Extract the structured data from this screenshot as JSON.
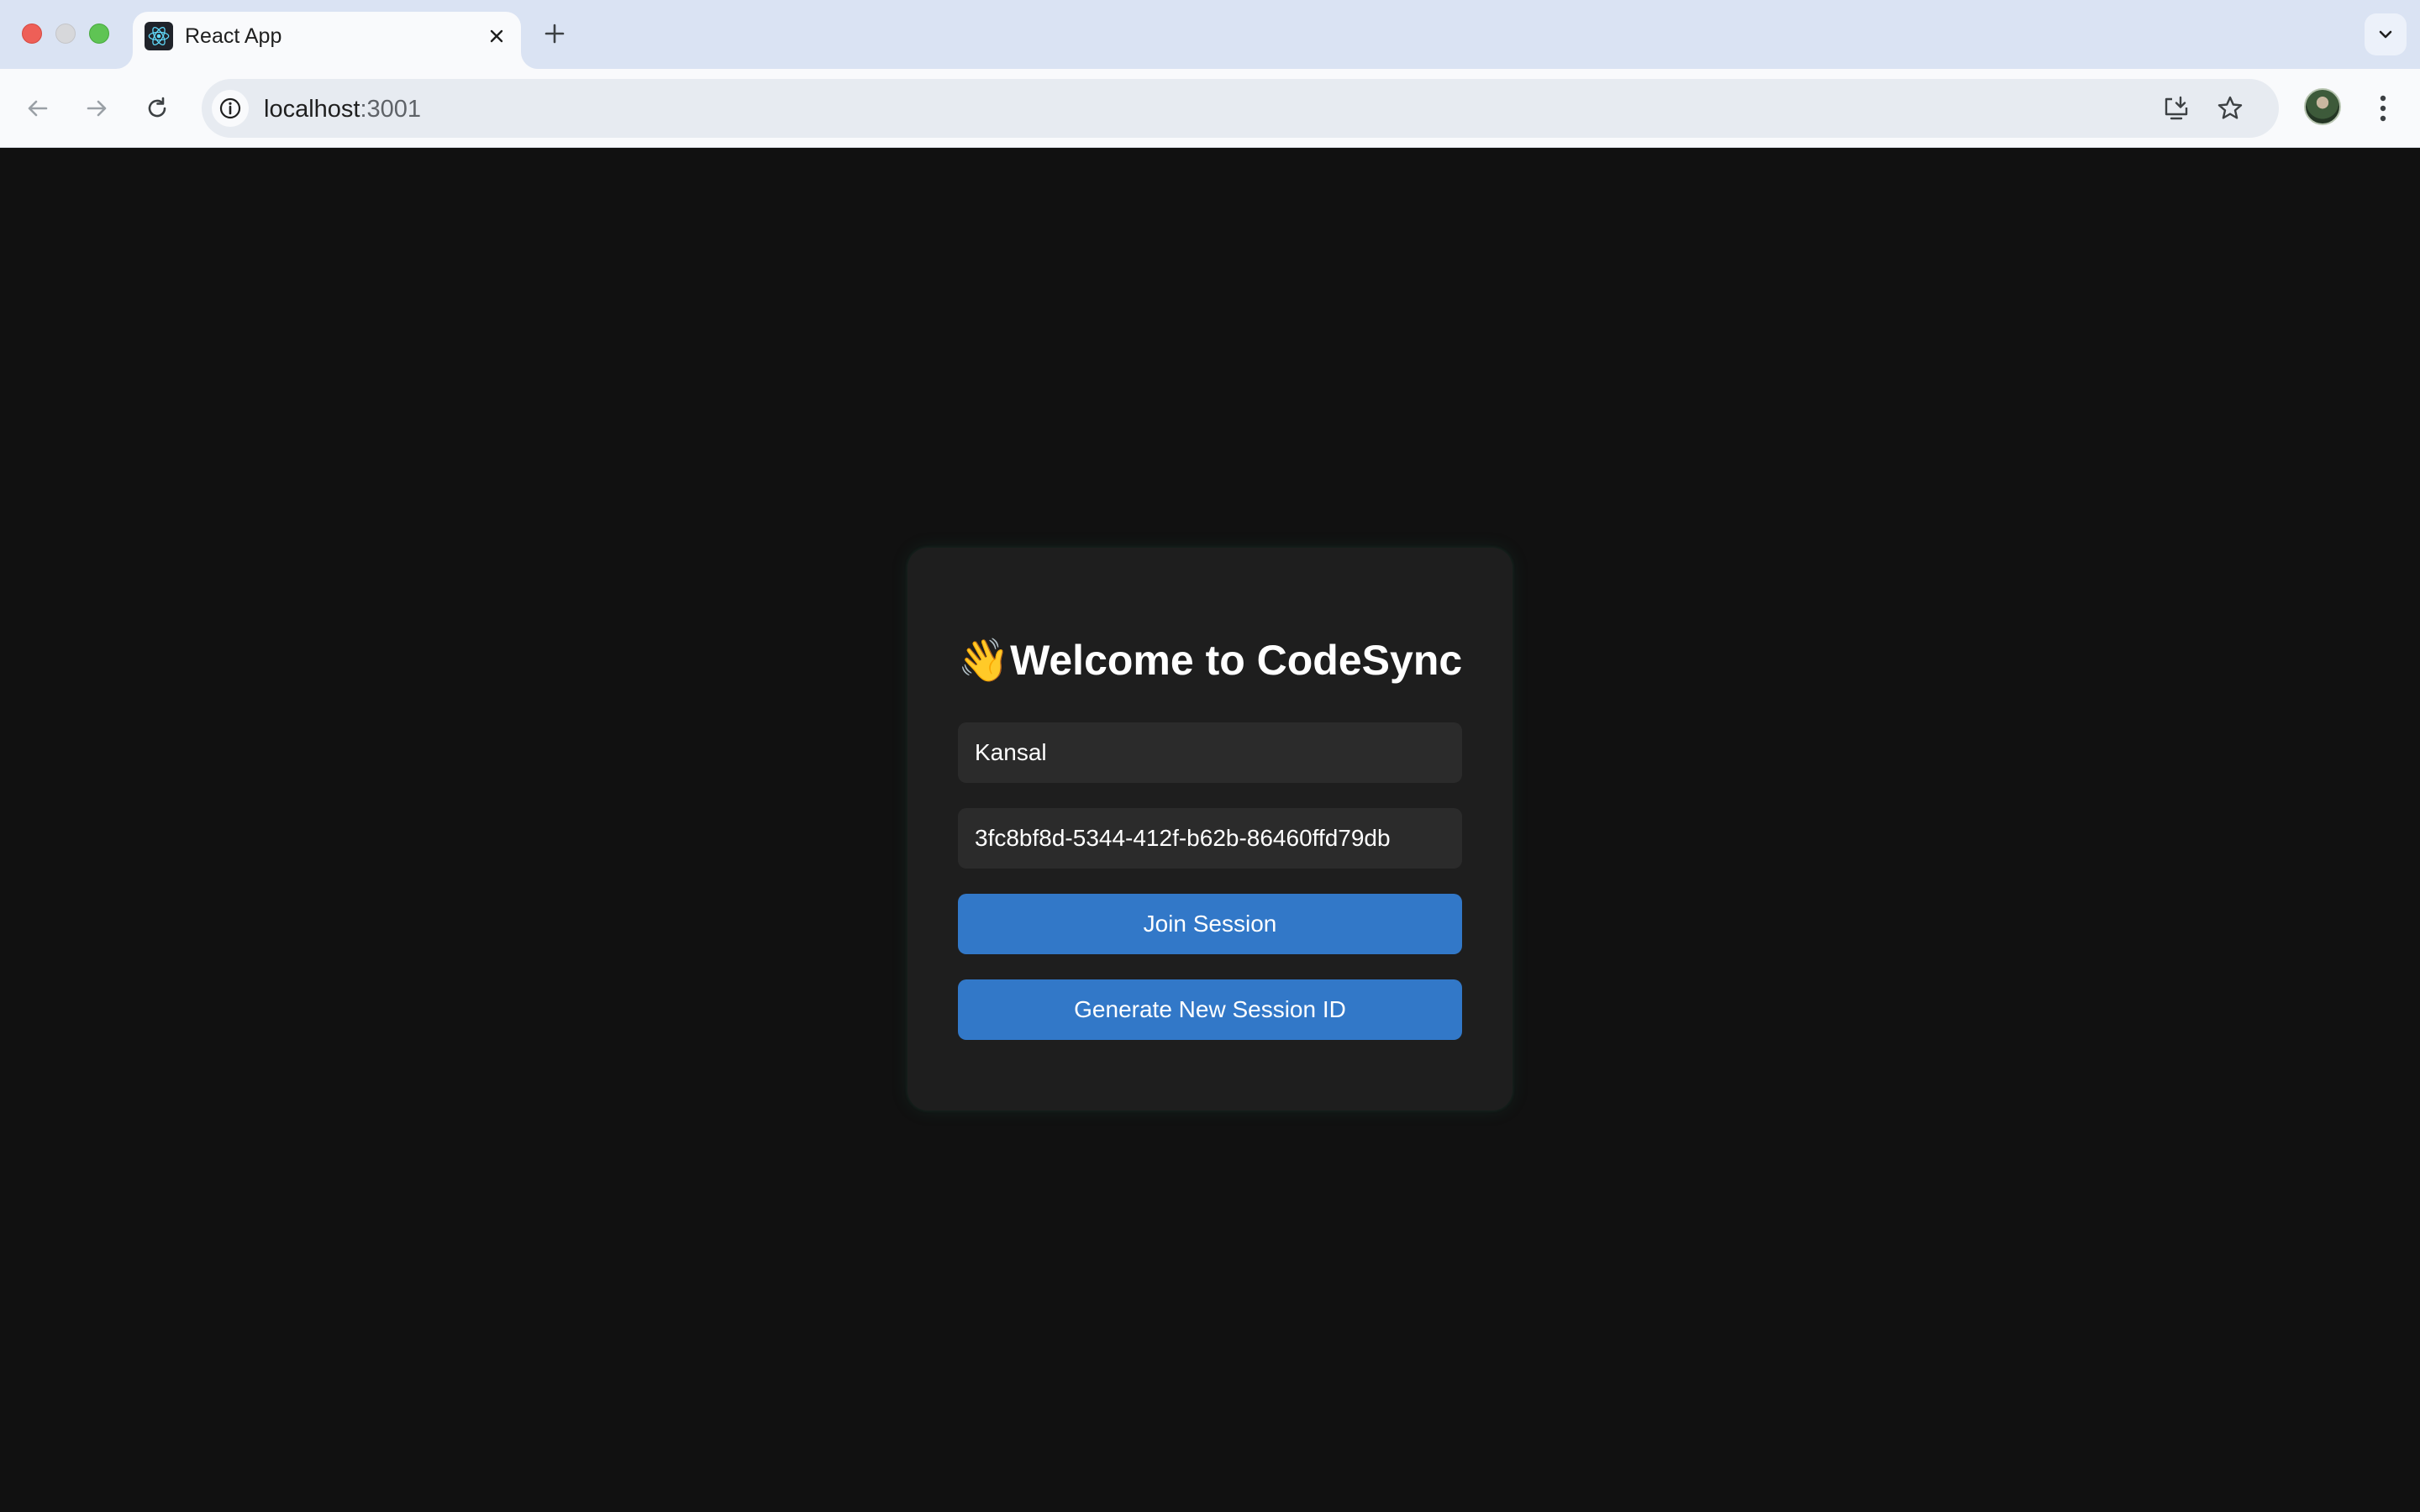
{
  "browser": {
    "tab": {
      "title": "React App",
      "favicon": "react-logo-icon"
    },
    "address": {
      "host": "localhost",
      "port": ":3001"
    },
    "icons": [
      "back-arrow-icon",
      "forward-arrow-icon",
      "reload-icon",
      "site-info-icon",
      "install-app-icon",
      "bookmark-star-icon",
      "profile-avatar",
      "more-menu-icon",
      "new-tab-icon",
      "tab-search-icon"
    ]
  },
  "welcome": {
    "emoji": "👋",
    "title": "Welcome to CodeSync",
    "username_value": "Kansal",
    "session_id_value": "3fc8bf8d-5344-412f-b62b-86460ffd79db",
    "join_label": "Join Session",
    "generate_label": "Generate New Session ID"
  },
  "colors": {
    "background": "#111111",
    "card": "#1e1e1e",
    "input": "#2b2b2b",
    "button": "#3278c8",
    "text": "#ffffff"
  }
}
